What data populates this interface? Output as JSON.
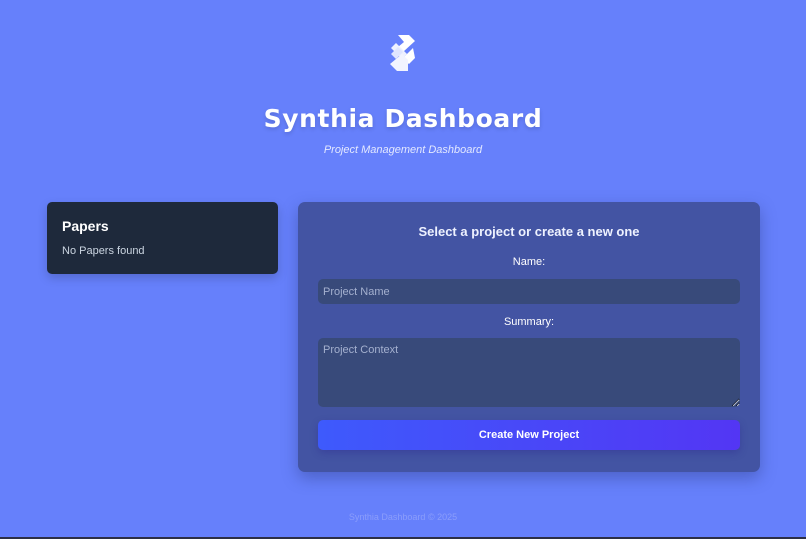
{
  "header": {
    "logo_icon": "synthia-s-logo-icon",
    "title": "Synthia Dashboard",
    "subtitle": "Project Management Dashboard"
  },
  "papers": {
    "title": "Papers",
    "empty_message": "No Papers found"
  },
  "project_form": {
    "heading": "Select a project or create a new one",
    "name_label": "Name:",
    "name_placeholder": "Project Name",
    "name_value": "",
    "summary_label": "Summary:",
    "summary_placeholder": "Project Context",
    "summary_value": "",
    "create_button": "Create New Project"
  },
  "footer": {
    "text": "Synthia Dashboard © 2025"
  },
  "colors": {
    "background": "#6680fb",
    "papers_card": "#1e293b",
    "form_card": "#4354a3",
    "input_bg": "#384a7a",
    "button_gradient_start": "#3e5afc",
    "button_gradient_end": "#5336f4"
  }
}
